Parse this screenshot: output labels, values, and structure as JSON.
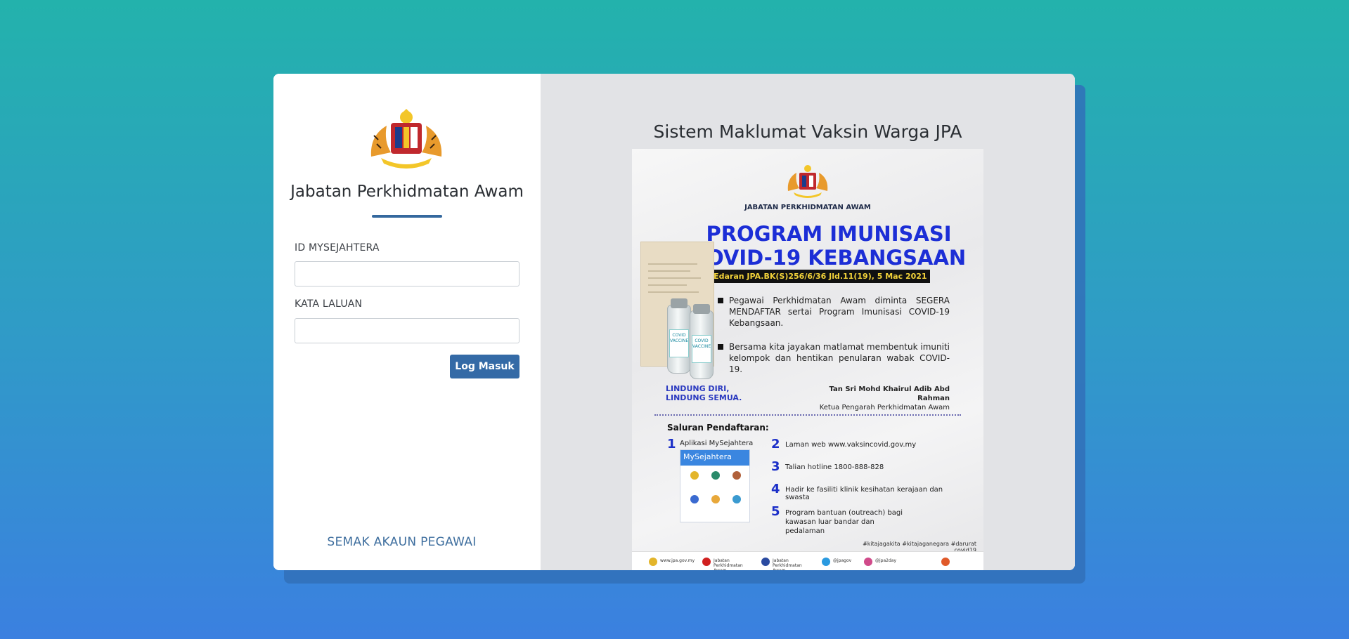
{
  "left_panel": {
    "agency_name": "Jabatan Perkhidmatan Awam",
    "id_label": "ID MYSEJAHTERA",
    "id_value": "",
    "password_label": "KATA LALUAN",
    "password_value": "",
    "login_button": "Log Masuk",
    "check_account_link": "SEMAK AKAUN PEGAWAI"
  },
  "right_panel": {
    "title": "Sistem Maklumat Vaksin Warga JPA",
    "poster": {
      "department": "JABATAN PERKHIDMATAN AWAM",
      "heading_line1": "PROGRAM IMUNISASI",
      "heading_line2": "COVID-19 KEBANGSAAN",
      "circular": "Surat Edaran JPA.BK(S)256/6/36 Jld.11(19), 5 Mac 2021",
      "bullet1": "Pegawai Perkhidmatan Awam diminta SEGERA MENDAFTAR sertai Program Imunisasi COVID-19 Kebangsaan.",
      "bullet2": "Bersama kita jayakan matlamat membentuk imuniti kelompok dan hentikan penularan wabak COVID-19.",
      "slogan_line1": "LINDUNG DIRI,",
      "slogan_line2": "LINDUNG SEMUA.",
      "signatory_name": "Tan Sri Mohd Khairul Adib Abd Rahman",
      "signatory_title": "Ketua Pengarah Perkhidmatan Awam",
      "registration_heading": "Saluran Pendaftaran:",
      "channels": [
        {
          "num": "1",
          "text": "Aplikasi MySejahtera"
        },
        {
          "num": "2",
          "text": "Laman web www.vaksincovid.gov.my"
        },
        {
          "num": "3",
          "text": "Talian hotline 1800-888-828"
        },
        {
          "num": "4",
          "text": "Hadir ke fasiliti klinik kesihatan kerajaan dan swasta"
        },
        {
          "num": "5",
          "text": "Program bantuan (outreach) bagi kawasan luar bandar dan pedalaman"
        }
      ],
      "app_name": "MySejahtera",
      "hashtags": "#kitajagakita #kitajaganegara #darurat covid19",
      "footer": [
        "www.jpa.gov.my",
        "Jabatan Perkhidmatan Awam",
        "Jabatan Perkhidmatan Awam",
        "@jpagov",
        "@jpa2day"
      ]
    }
  },
  "colors": {
    "primary": "#346aa6",
    "link": "#3e6e9e",
    "poster_heading": "#1c2ed6"
  }
}
